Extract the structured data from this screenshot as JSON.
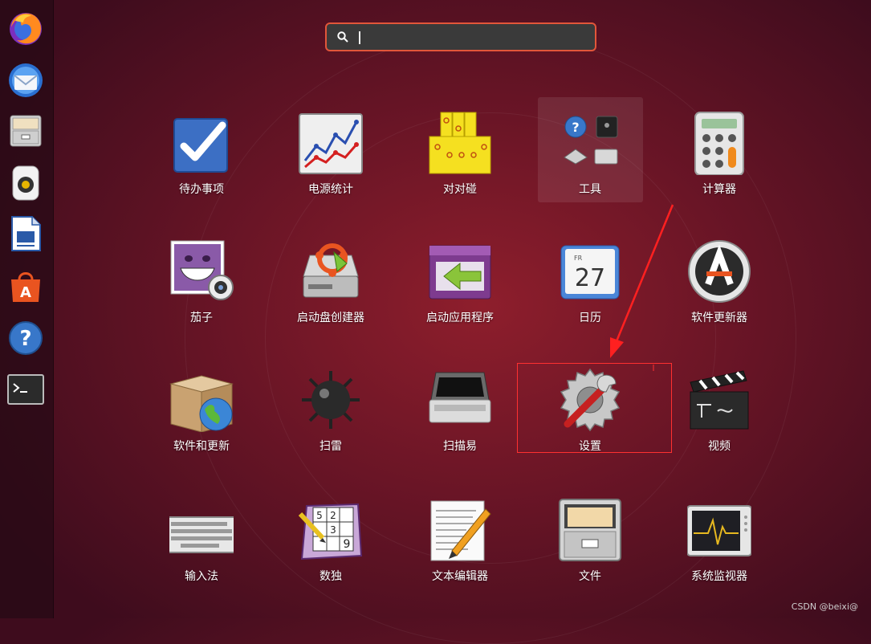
{
  "search": {
    "value": "",
    "placeholder": ""
  },
  "dock": [
    {
      "name": "firefox-icon"
    },
    {
      "name": "thunderbird-icon"
    },
    {
      "name": "file-cabinet-icon"
    },
    {
      "name": "speaker-icon"
    },
    {
      "name": "writer-document-icon"
    },
    {
      "name": "software-store-icon"
    },
    {
      "name": "help-icon"
    },
    {
      "name": "terminal-icon"
    }
  ],
  "apps": [
    {
      "label": "待办事项"
    },
    {
      "label": "电源统计"
    },
    {
      "label": "对对碰"
    },
    {
      "label": "工具"
    },
    {
      "label": "计算器"
    },
    {
      "label": "茄子"
    },
    {
      "label": "启动盘创建器"
    },
    {
      "label": "启动应用程序"
    },
    {
      "label": "日历",
      "day": "27",
      "weekday": "FR"
    },
    {
      "label": "软件更新器"
    },
    {
      "label": "软件和更新"
    },
    {
      "label": "扫雷"
    },
    {
      "label": "扫描易"
    },
    {
      "label": "设置"
    },
    {
      "label": "视频"
    },
    {
      "label": "输入法"
    },
    {
      "label": "数独",
      "digits": [
        "5",
        "2",
        "3",
        "9"
      ]
    },
    {
      "label": "文本编辑器"
    },
    {
      "label": "文件"
    },
    {
      "label": "系统监视器"
    }
  ],
  "watermark": "CSDN @beixi@",
  "colors": {
    "highlight": "#ff3030",
    "search_border": "#e2563a",
    "ubuntu_orange": "#e95420"
  }
}
